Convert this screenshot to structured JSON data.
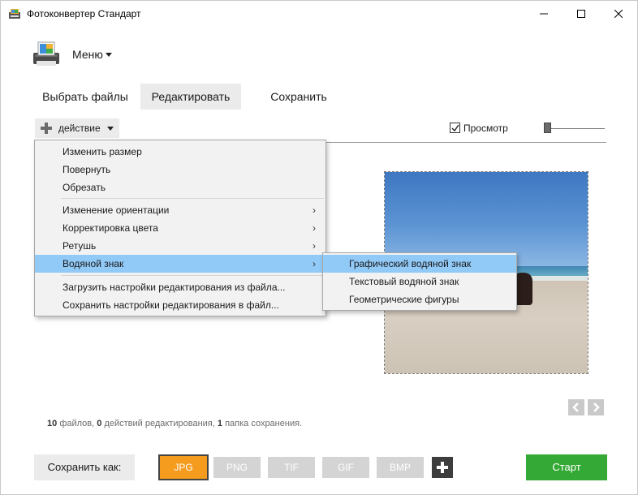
{
  "window": {
    "title": "Фотоконвертер Стандарт"
  },
  "menu": {
    "label": "Меню"
  },
  "tabs": [
    {
      "label": "Выбрать файлы",
      "active": false
    },
    {
      "label": "Редактировать",
      "active": true
    },
    {
      "label": "Сохранить",
      "active": false
    }
  ],
  "toolbar": {
    "action_label": "действие",
    "preview_label": "Просмотр",
    "preview_checked": true
  },
  "action_menu": {
    "items": [
      {
        "label": "Изменить размер",
        "submenu": false
      },
      {
        "label": "Повернуть",
        "submenu": false
      },
      {
        "label": "Обрезать",
        "submenu": false
      },
      {
        "label": "Изменение ориентации",
        "submenu": true
      },
      {
        "label": "Корректировка цвета",
        "submenu": true
      },
      {
        "label": "Ретушь",
        "submenu": true
      },
      {
        "label": "Водяной знак",
        "submenu": true,
        "highlighted": true
      },
      {
        "label": "Загрузить настройки редактирования из файла...",
        "submenu": false
      },
      {
        "label": "Сохранить настройки редактирования в файл...",
        "submenu": false
      }
    ],
    "arrow_glyph": "›"
  },
  "watermark_submenu": {
    "items": [
      {
        "label": "Графический водяной знак",
        "highlighted": true
      },
      {
        "label": "Текстовый водяной знак",
        "highlighted": false
      },
      {
        "label": "Геометрические фигуры",
        "highlighted": false
      }
    ]
  },
  "status": {
    "files_count": "10",
    "files_text": "файлов,",
    "actions_count": "0",
    "actions_text": "действий редактирования,",
    "folders_count": "1",
    "folders_text": "папка сохранения."
  },
  "bottom": {
    "save_as_label": "Сохранить как:",
    "formats": [
      {
        "label": "JPG",
        "selected": true
      },
      {
        "label": "PNG",
        "selected": false
      },
      {
        "label": "TIF",
        "selected": false
      },
      {
        "label": "GIF",
        "selected": false
      },
      {
        "label": "BMP",
        "selected": false
      }
    ],
    "start_label": "Старт"
  },
  "colors": {
    "accent_orange": "#f59b1d",
    "start_green": "#35a935",
    "menu_highlight": "#91c9f7"
  },
  "icons": {
    "app": "app-icon",
    "minimize": "minimize-icon",
    "maximize": "maximize-icon",
    "close": "close-icon",
    "menu_logo": "converter-logo-icon",
    "add": "plus-icon",
    "prev": "chevron-left-icon",
    "next": "chevron-right-icon"
  }
}
